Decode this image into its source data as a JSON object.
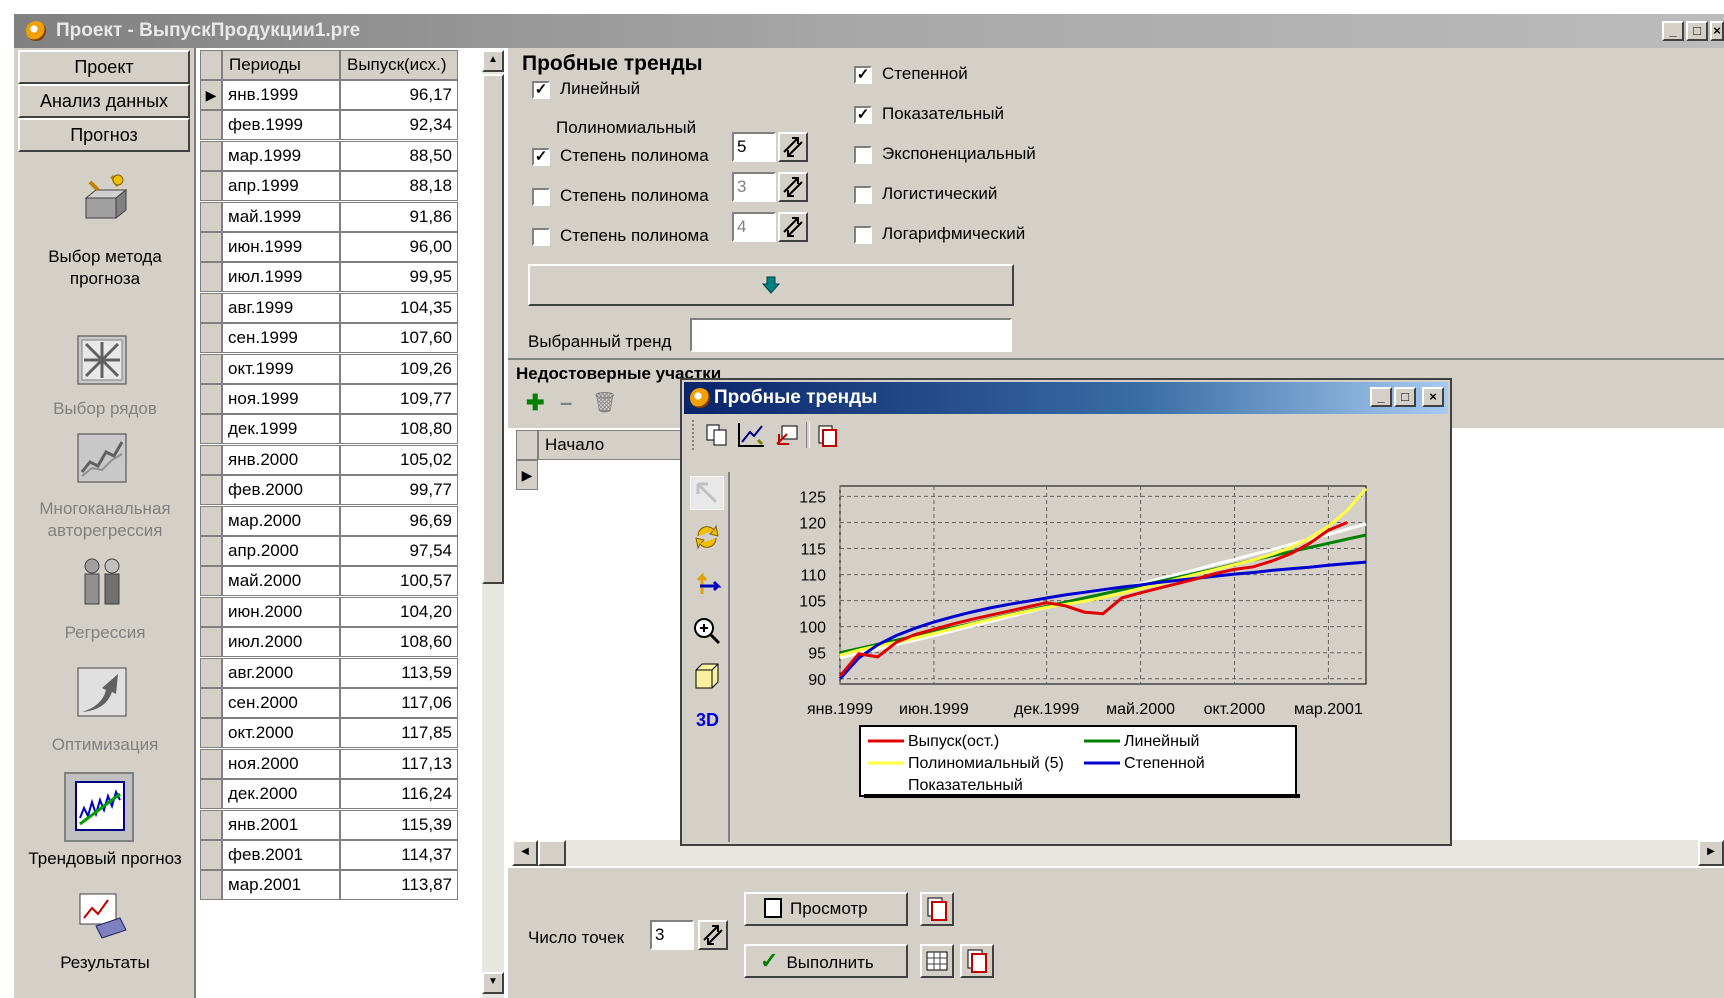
{
  "window": {
    "title": "Проект - ВыпускПродукции1.pre"
  },
  "nav": {
    "buttons": [
      "Проект",
      "Анализ данных",
      "Прогноз"
    ],
    "items": [
      {
        "label": "Выбор метода\nпрогноза",
        "icon": "method-select-icon",
        "disabled": false
      },
      {
        "label": "Выбор рядов",
        "icon": "series-select-icon",
        "disabled": true
      },
      {
        "label": "Многоканальная\nавторегрессия",
        "icon": "autoregression-icon",
        "disabled": true
      },
      {
        "label": "Регрессия",
        "icon": "regression-icon",
        "disabled": true
      },
      {
        "label": "Оптимизация",
        "icon": "optimization-icon",
        "disabled": true
      },
      {
        "label": "Трендовый прогноз",
        "icon": "trend-forecast-icon",
        "disabled": false
      },
      {
        "label": "Результаты",
        "icon": "results-icon",
        "disabled": false
      }
    ]
  },
  "table": {
    "headers": [
      "Периоды",
      "Выпуск(исх.)"
    ],
    "rows": [
      [
        "янв.1999",
        "96,17"
      ],
      [
        "фев.1999",
        "92,34"
      ],
      [
        "мар.1999",
        "88,50"
      ],
      [
        "апр.1999",
        "88,18"
      ],
      [
        "май.1999",
        "91,86"
      ],
      [
        "июн.1999",
        "96,00"
      ],
      [
        "июл.1999",
        "99,95"
      ],
      [
        "авг.1999",
        "104,35"
      ],
      [
        "сен.1999",
        "107,60"
      ],
      [
        "окт.1999",
        "109,26"
      ],
      [
        "ноя.1999",
        "109,77"
      ],
      [
        "дек.1999",
        "108,80"
      ],
      [
        "янв.2000",
        "105,02"
      ],
      [
        "фев.2000",
        "99,77"
      ],
      [
        "мар.2000",
        "96,69"
      ],
      [
        "апр.2000",
        "97,54"
      ],
      [
        "май.2000",
        "100,57"
      ],
      [
        "июн.2000",
        "104,20"
      ],
      [
        "июл.2000",
        "108,60"
      ],
      [
        "авг.2000",
        "113,59"
      ],
      [
        "сен.2000",
        "117,06"
      ],
      [
        "окт.2000",
        "117,85"
      ],
      [
        "ноя.2000",
        "117,13"
      ],
      [
        "дек.2000",
        "116,24"
      ],
      [
        "янв.2001",
        "115,39"
      ],
      [
        "фев.2001",
        "114,37"
      ],
      [
        "мар.2001",
        "113,87"
      ]
    ]
  },
  "trends": {
    "heading": "Пробные тренды",
    "linear": {
      "label": "Линейный",
      "checked": true
    },
    "poly_heading": "Полиномиальный",
    "poly": [
      {
        "label": "Степень полинома",
        "checked": true,
        "degree": "5"
      },
      {
        "label": "Степень полинома",
        "checked": false,
        "degree": "3"
      },
      {
        "label": "Степень полинома",
        "checked": false,
        "degree": "4"
      }
    ],
    "right": [
      {
        "label": "Степенной",
        "checked": true
      },
      {
        "label": "Показательный",
        "checked": true
      },
      {
        "label": "Экспоненциальный",
        "checked": false
      },
      {
        "label": "Логистический",
        "checked": false
      },
      {
        "label": "Логарифмический",
        "checked": false
      }
    ],
    "selected_label": "Выбранный тренд",
    "selected_value": ""
  },
  "unreliable": {
    "heading": "Недостоверные участки",
    "col_start": "Начало"
  },
  "bottom": {
    "points_label": "Число точек",
    "points_value": "3",
    "preview_label": "Просмотр",
    "run_label": "Выполнить"
  },
  "dialog": {
    "title": "Пробные тренды",
    "tool_3d": "3D"
  },
  "colors": {
    "actual": "#e00000",
    "linear": "#008000",
    "polynomial": "#ffff40",
    "power": "#0000d0",
    "exponential": "#ffffff"
  },
  "chart_data": {
    "type": "line",
    "title": "",
    "xlabel": "",
    "ylabel": "",
    "x_ticks": [
      "янв.1999",
      "июн.1999",
      "дек.1999",
      "май.2000",
      "окт.2000",
      "мар.2001"
    ],
    "y_ticks": [
      125,
      120,
      115,
      110,
      105,
      100,
      95,
      90
    ],
    "ylim": [
      89,
      127
    ],
    "grid": true,
    "legend_position": "bottom",
    "x": [
      "янв.1999",
      "фев.1999",
      "мар.1999",
      "апр.1999",
      "май.1999",
      "июн.1999",
      "июл.1999",
      "авг.1999",
      "сен.1999",
      "окт.1999",
      "ноя.1999",
      "дек.1999",
      "янв.2000",
      "фев.2000",
      "мар.2000",
      "апр.2000",
      "май.2000",
      "июн.2000",
      "июл.2000",
      "авг.2000",
      "сен.2000",
      "окт.2000",
      "ноя.2000",
      "дек.2000",
      "янв.2001",
      "фев.2001",
      "мар.2001",
      "апр.2001",
      "май.2001"
    ],
    "series": [
      {
        "name": "Выпуск(ост.)",
        "values": [
          90.5,
          94.8,
          94.2,
          97.0,
          98.5,
          99.5,
          100.5,
          101.4,
          102.2,
          103.0,
          103.8,
          104.6,
          104.0,
          102.8,
          102.5,
          105.5,
          106.5,
          107.4,
          108.3,
          109.2,
          110.2,
          111.0,
          111.5,
          112.6,
          114.0,
          116.0,
          118.5,
          120.0,
          null
        ]
      },
      {
        "name": "Линейный",
        "values": [
          95.0,
          95.8,
          96.6,
          97.4,
          98.2,
          99.0,
          99.8,
          100.6,
          101.5,
          102.3,
          103.1,
          103.9,
          104.7,
          105.5,
          106.3,
          107.1,
          107.9,
          108.7,
          109.5,
          110.3,
          111.1,
          112.0,
          112.8,
          113.6,
          114.4,
          115.2,
          116.0,
          116.8,
          117.6
        ]
      },
      {
        "name": "Полиномиальный (5)",
        "values": [
          94.5,
          95.5,
          96.3,
          97.0,
          97.8,
          98.7,
          99.6,
          100.5,
          101.4,
          102.2,
          103.0,
          103.7,
          104.3,
          104.9,
          105.6,
          106.4,
          107.3,
          108.2,
          109.2,
          110.1,
          111.0,
          111.9,
          112.8,
          113.9,
          115.2,
          117.0,
          119.3,
          122.3,
          126.5
        ]
      },
      {
        "name": "Степенной",
        "values": [
          90.0,
          94.0,
          96.5,
          98.3,
          99.7,
          100.9,
          101.9,
          102.8,
          103.6,
          104.3,
          104.9,
          105.5,
          106.1,
          106.6,
          107.1,
          107.6,
          108.0,
          108.5,
          108.9,
          109.3,
          109.7,
          110.1,
          110.4,
          110.8,
          111.1,
          111.4,
          111.8,
          112.1,
          112.4
        ]
      },
      {
        "name": "Показательный",
        "values": [
          94.0,
          94.9,
          95.7,
          96.6,
          97.4,
          98.3,
          99.2,
          100.1,
          101.0,
          101.9,
          102.8,
          103.7,
          104.6,
          105.5,
          106.4,
          107.3,
          108.2,
          109.2,
          110.1,
          111.0,
          112.0,
          112.9,
          113.9,
          114.8,
          115.8,
          116.8,
          117.7,
          118.7,
          119.7
        ]
      }
    ]
  }
}
